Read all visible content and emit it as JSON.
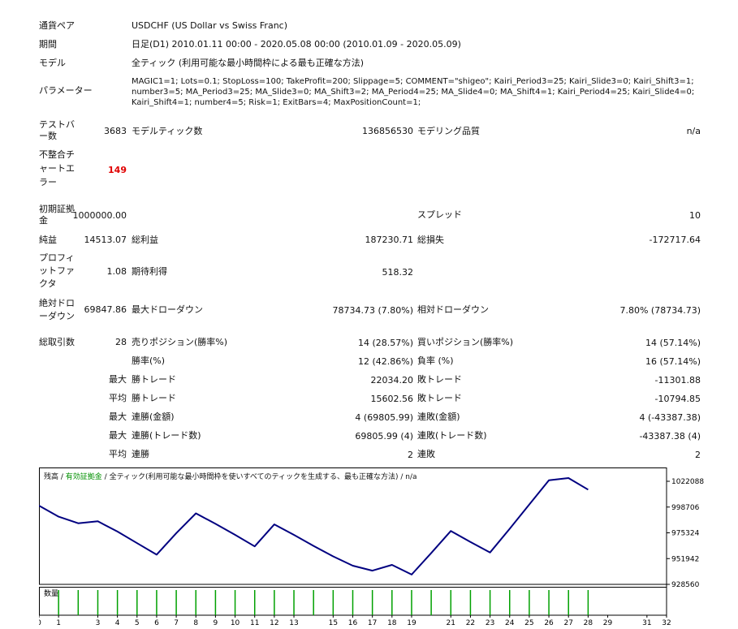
{
  "summary": {
    "pair_label": "通貨ペア",
    "pair_value": "USDCHF (US Dollar vs Swiss Franc)",
    "period_label": "期間",
    "period_value": "日足(D1) 2010.01.11 00:00 - 2020.05.08 00:00 (2010.01.09 - 2020.05.09)",
    "model_label": "モデル",
    "model_value": "全ティック (利用可能な最小時間枠による最も正確な方法)",
    "params_label": "パラメーター",
    "params_line1": "MAGIC1=1; Lots=0.1; StopLoss=100; TakeProfit=200; Slippage=5; COMMENT=\"shigeo\"; Kairi_Period3=25; Kairi_Slide3=0; Kairi_Shift3=1;",
    "params_line2": "number3=5; MA_Period3=25; MA_Slide3=0; MA_Shift3=2; MA_Period4=25; MA_Slide4=0; MA_Shift4=1; Kairi_Period4=25; Kairi_Slide4=0;",
    "params_line3": "Kairi_Shift4=1; number4=5; Risk=1; ExitBars=4; MaxPositionCount=1;",
    "bars_label_1": "テストバ",
    "bars_label_2": "ー数",
    "bars_value": "3683",
    "ticks_label": "モデルティック数",
    "ticks_value": "136856530",
    "quality_label": "モデリング品質",
    "quality_value": "n/a",
    "mismatch_label_1": "不整合チ",
    "mismatch_label_2": "ャートエ",
    "mismatch_label_3": "ラー",
    "mismatch_value": "149",
    "deposit_label_1": "初期証拠",
    "deposit_label_2": "金",
    "deposit_value": "1000000.00",
    "spread_label": "スプレッド",
    "spread_value": "10",
    "net_label": "純益",
    "net_value": "14513.07",
    "gross_profit_label": "総利益",
    "gross_profit_value": "187230.71",
    "gross_loss_label": "総損失",
    "gross_loss_value": "-172717.64",
    "pf_label_1": "プロフィ",
    "pf_label_2": "ットファ",
    "pf_label_3": "クタ",
    "pf_value": "1.08",
    "expected_label": "期待利得",
    "expected_value": "518.32",
    "abs_dd_label_1": "絶対ドロ",
    "abs_dd_label_2": "ーダウン",
    "abs_dd_value": "69847.86",
    "max_dd_label": "最大ドローダウン",
    "max_dd_value": "78734.73 (7.80%)",
    "rel_dd_label": "相対ドローダウン",
    "rel_dd_value": "7.80% (78734.73)",
    "trades_label": "総取引数",
    "trades_value": "28",
    "short_label": "売りポジション(勝率%)",
    "short_value": "14 (28.57%)",
    "long_label": "買いポジション(勝率%)",
    "long_value": "14 (57.14%)",
    "winrate_label": "勝率(%)",
    "winrate_value": "12 (42.86%)",
    "lossrate_label": "負率 (%)",
    "lossrate_value": "16 (57.14%)",
    "largest_q": "最大",
    "largest_win_label": "勝トレード",
    "largest_win_value": "22034.20",
    "largest_loss_label": "敗トレード",
    "largest_loss_value": "-11301.88",
    "avg_q": "平均",
    "avg_win_label": "勝トレード",
    "avg_win_value": "15602.56",
    "avg_loss_label": "敗トレード",
    "avg_loss_value": "-10794.85",
    "max_consec_q": "最大",
    "max_consec_win_label": "連勝(金額)",
    "max_consec_win_value": "4 (69805.99)",
    "max_consec_loss_label": "連敗(金額)",
    "max_consec_loss_value": "4 (-43387.38)",
    "max_consec_q2": "最大",
    "max_consec_win2_label": "連勝(トレード数)",
    "max_consec_win2_value": "69805.99 (4)",
    "max_consec_loss2_label": "連敗(トレード数)",
    "max_consec_loss2_value": "-43387.38 (4)",
    "avg_consec_q": "平均",
    "avg_consec_win_label": "連勝",
    "avg_consec_win_value": "2",
    "avg_consec_loss_label": "連敗",
    "avg_consec_loss_value": "2"
  },
  "chart_legend": {
    "balance": "残高",
    "sep1": " / ",
    "equity": "有効証拠金",
    "sep2": " / ",
    "model": "全ティック(利用可能な最小時間枠を使いすべてのティックを生成する、最も正確な方法)",
    "sep3": " / ",
    "quality": "n/a"
  },
  "chart_data": {
    "type": "line",
    "title": "",
    "series": [
      {
        "name": "残高",
        "color": "#000080",
        "x": [
          0,
          1,
          2,
          3,
          4,
          5,
          6,
          7,
          8,
          9,
          10,
          11,
          12,
          13,
          14,
          15,
          16,
          17,
          18,
          19,
          20,
          21,
          22,
          23,
          24,
          25,
          26,
          27,
          28
        ],
        "y": [
          1000000,
          990000,
          984000,
          985800,
          976500,
          966000,
          955500,
          975000,
          993000,
          983500,
          973500,
          963000,
          983000,
          973500,
          963500,
          954000,
          945500,
          941000,
          946200,
          937500,
          957000,
          977000,
          967000,
          957500,
          979000,
          1001000,
          1023000,
          1025000,
          1014500
        ]
      }
    ],
    "y_ticks": [
      1022088,
      998706,
      975324,
      951942,
      928560
    ],
    "ylim": [
      928560,
      1022088
    ],
    "x_ticks": [
      0,
      1,
      3,
      4,
      5,
      6,
      7,
      8,
      9,
      10,
      11,
      12,
      13,
      15,
      16,
      17,
      18,
      19,
      21,
      22,
      23,
      24,
      25,
      26,
      27,
      28,
      29,
      31,
      32
    ],
    "volume_label": "数量",
    "volume_color": "#00a000",
    "volume_count": 29,
    "grid": false,
    "legend": "top-left"
  }
}
